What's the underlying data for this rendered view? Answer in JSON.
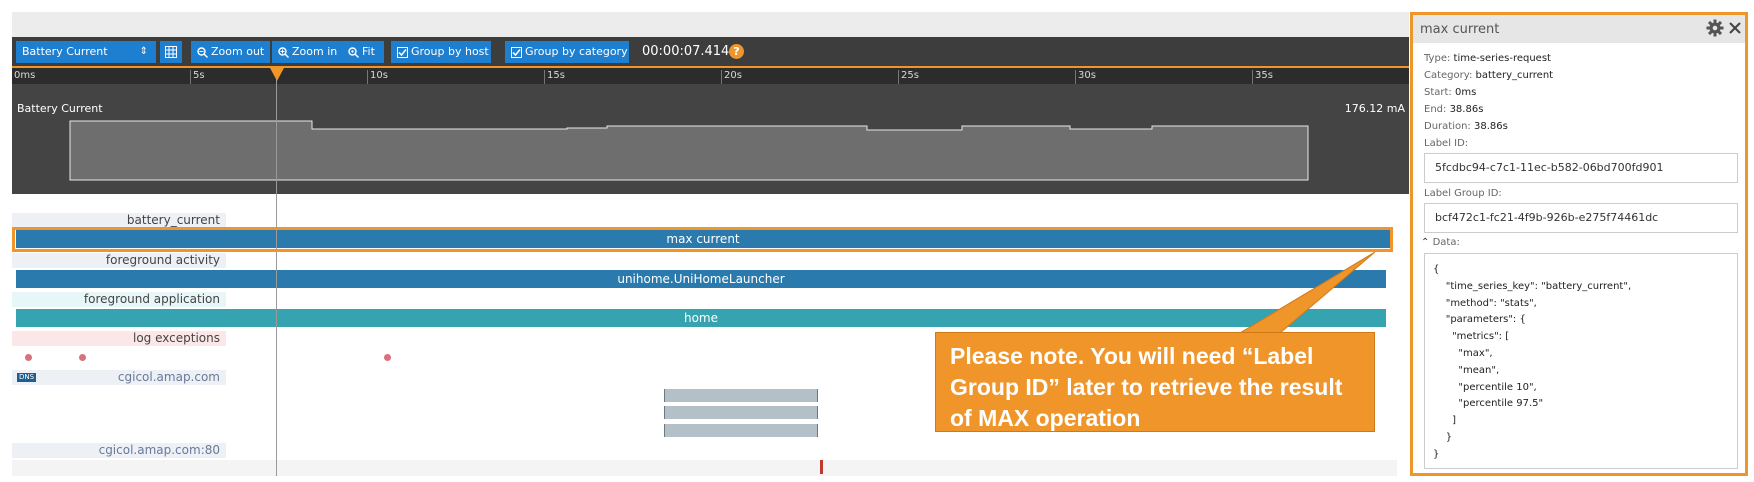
{
  "toolbar": {
    "series_select": "Battery Current",
    "zoom_out": "Zoom out",
    "zoom_in": "Zoom in",
    "fit": "Fit",
    "group_by_host": "Group by host",
    "group_by_category": "Group by category",
    "time": "00:00:07.414",
    "help": "?"
  },
  "ruler": {
    "ticks": [
      "0ms",
      "5s",
      "10s",
      "15s",
      "20s",
      "25s",
      "30s",
      "35s"
    ]
  },
  "battery": {
    "label": "Battery Current",
    "max_value": "176.12 mA"
  },
  "tracks": {
    "battery_current_label": "battery_current",
    "max_current_bar": "max current",
    "foreground_activity_label": "foreground activity",
    "foreground_activity_bar": "unihome.UniHomeLauncher",
    "foreground_application_label": "foreground application",
    "foreground_application_bar": "home",
    "log_exceptions_label": "log exceptions",
    "dns_badge": "DNS",
    "dns_host_label": "cgicol.amap.com",
    "host_port_label": "cgicol.amap.com:80"
  },
  "panel": {
    "title": "max current",
    "type_label": "Type:",
    "type_value": "time-series-request",
    "category_label": "Category:",
    "category_value": "battery_current",
    "start_label": "Start:",
    "start_value": "0ms",
    "end_label": "End:",
    "end_value": "38.86s",
    "duration_label": "Duration:",
    "duration_value": "38.86s",
    "label_id_label": "Label ID:",
    "label_id_value": "5fcdbc94-c7c1-11ec-b582-06bd700fd901",
    "label_group_id_label": "Label Group ID:",
    "label_group_id_value": "bcf472c1-fc21-4f9b-926b-e275f74461dc",
    "data_label": "Data:",
    "data_json": "{\n    \"time_series_key\": \"battery_current\",\n    \"method\": \"stats\",\n    \"parameters\": {\n      \"metrics\": [\n        \"max\",\n        \"mean\",\n        \"percentile 10\",\n        \"percentile 97.5\"\n      ]\n    }\n}"
  },
  "callout": {
    "text": "Please note. You will need “Label Group ID” later to retrieve the result of MAX operation"
  },
  "colors": {
    "accent_orange": "#f0952a",
    "toolbar_blue": "#1e7fd1",
    "bar_blue": "#2a7aad",
    "bar_teal": "#35a3b0"
  }
}
